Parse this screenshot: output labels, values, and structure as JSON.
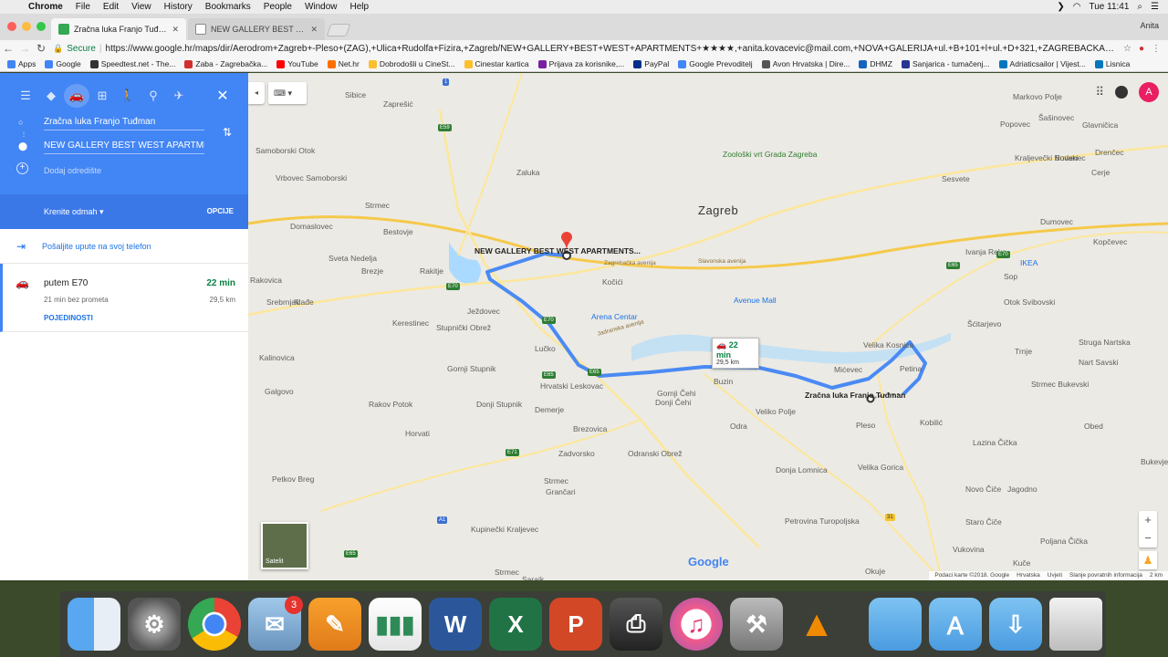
{
  "menubar": {
    "app": "Chrome",
    "items": [
      "File",
      "Edit",
      "View",
      "History",
      "Bookmarks",
      "People",
      "Window",
      "Help"
    ],
    "clock": "Tue 11:41"
  },
  "tabs": [
    {
      "title": "Zračna luka Franjo Tuđman do"
    },
    {
      "title": "NEW GALLERY BEST WEST AP"
    }
  ],
  "profile_name": "Anita",
  "toolbar": {
    "secure_label": "Secure",
    "url": "https://www.google.hr/maps/dir/Aerodrom+Zagreb+-Pleso+(ZAG),+Ulica+Rudolfa+Fizira,+Zagreb/NEW+GALLERY+BEST+WEST+APARTMENTS+★★★★,+anita.kovacevic@mail.com,+NOVA+GALERIJA+ul.+B+101+l+ul.+D+321,+ZAGREBAČKA+AVENIJA+10..."
  },
  "bookmarks": [
    {
      "label": "Apps",
      "color": "#4285f4"
    },
    {
      "label": "Google",
      "color": "#4285f4"
    },
    {
      "label": "Speedtest.net - The...",
      "color": "#333333"
    },
    {
      "label": "Zaba - Zagrebačka...",
      "color": "#d32f2f"
    },
    {
      "label": "YouTube",
      "color": "#ff0000"
    },
    {
      "label": "Net.hr",
      "color": "#ff6f00"
    },
    {
      "label": "Dobrodošli u CineSt...",
      "color": "#fbc02d"
    },
    {
      "label": "Cinestar kartica",
      "color": "#fbc02d"
    },
    {
      "label": "Prijava za korisnike,...",
      "color": "#7b1fa2"
    },
    {
      "label": "PayPal",
      "color": "#003087"
    },
    {
      "label": "Google Prevoditelj",
      "color": "#4285f4"
    },
    {
      "label": "Avon Hrvatska | Dire...",
      "color": "#555555"
    },
    {
      "label": "DHMZ",
      "color": "#1565c0"
    },
    {
      "label": "Sanjarica - tumačenj...",
      "color": "#283593"
    },
    {
      "label": "Adriaticsailor | Vijest...",
      "color": "#0277bd"
    },
    {
      "label": "Lisnica",
      "color": "#0277bd"
    }
  ],
  "directions": {
    "origin": "Zračna luka Franjo Tuđman",
    "destination": "NEW GALLERY BEST WEST APARTMENTS",
    "add_destination": "Dodaj odredište",
    "depart": "Krenite odmah",
    "options": "OPCIJE",
    "send_to_phone": "Pošaljite upute na svoj telefon",
    "route": {
      "via": "putem E70",
      "duration": "22 min",
      "no_traffic": "21 min bez prometa",
      "distance": "29,5 km",
      "details": "POJEDINOSTI"
    }
  },
  "map": {
    "city": "Zagreb",
    "destination_label": "NEW GALLERY BEST WEST APARTMENTS...",
    "origin_label": "Zračna luka Franjo Tuđman",
    "callout_duration": "22 min",
    "callout_distance": "29,5 km",
    "places": [
      "Sibice",
      "Zaprešić",
      "Samoborski Otok",
      "Vrbovec Samoborski",
      "Strmec",
      "Domaslovec",
      "Bestovje",
      "Sveta Nedelja",
      "Brezje",
      "Rakitje",
      "Rakovica",
      "Klađe",
      "Srebrnjak",
      "Kerestinec",
      "Stupnički Obrež",
      "Kalinovica",
      "Gornji Stupnik",
      "Galgovo",
      "Rakov Potok",
      "Horvati",
      "Petkov Breg",
      "Ježdovec",
      "Lučko",
      "Hrvatski Leskovac",
      "Donji Stupnik",
      "Demerje",
      "Brezovica",
      "Zadvorsko",
      "Grančari",
      "Kupinečki Kraljevec",
      "Strmec",
      "Odranski Obrež",
      "Gornji Čehi",
      "Donji Čehi",
      "Buzin",
      "Odra",
      "Veliko Polje",
      "Donja Lomnica",
      "Petrovina Turopoljska",
      "Velika Gorica",
      "Pleso",
      "Mićevec",
      "Velika Kosnica",
      "Petina",
      "Kobilić",
      "Lazina Čička",
      "Novo Čiče",
      "Jagodno",
      "Staro Čiče",
      "Vukovina",
      "Kuče",
      "Poljana Čička",
      "Okuje",
      "Zaluka",
      "Kočići",
      "Arena Centar",
      "Avenue Mall",
      "Zoološki vrt Grada Zagreba",
      "Sesvete",
      "Markovo Polje",
      "Popovec",
      "Šašinovec",
      "Glavničica",
      "Kraljevečki Novaki",
      "Budenec",
      "Drenčec",
      "Cerje",
      "Dumovec",
      "Ivanja Reka",
      "Kopčevec",
      "IKEA",
      "Sop",
      "Otok Svibovski",
      "Šćitarjevo",
      "Trnje",
      "Strmec Bukevski",
      "Struga Nartska",
      "Nart Savski",
      "Obed",
      "Bukevje",
      "Strmec",
      "Sarajk",
      "Donja"
    ],
    "satellite": "Satelit",
    "google": "Google",
    "attribution": [
      "Podaci karte ©2018. Google",
      "Hrvatska",
      "Uvjeti",
      "Slanje povratnih informacija",
      "2 km"
    ]
  },
  "dock": {
    "mail_badge": "3",
    "icons": [
      "finder-icon",
      "system-preferences-icon",
      "chrome-icon",
      "mail-icon",
      "pages-icon",
      "numbers-icon",
      "word-icon",
      "excel-icon",
      "powerpoint-icon",
      "printer-icon",
      "itunes-icon",
      "migration-icon",
      "vlc-icon",
      "folder-icon",
      "applications-folder-icon",
      "downloads-folder-icon",
      "trash-icon"
    ]
  }
}
